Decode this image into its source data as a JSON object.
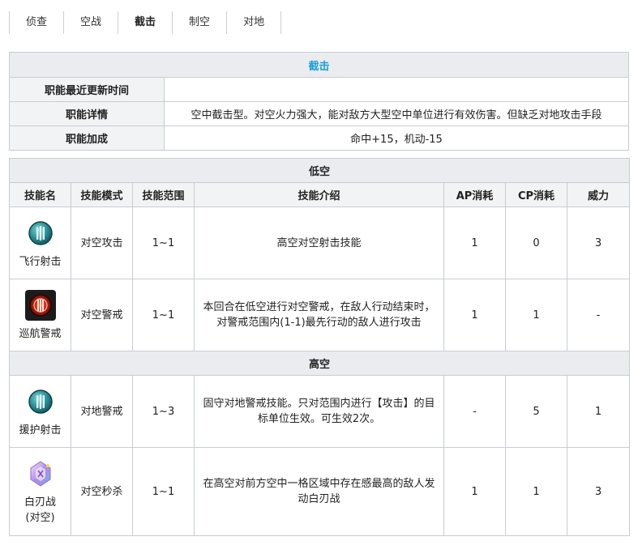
{
  "tabs": [
    "侦查",
    "空战",
    "截击",
    "制空",
    "对地"
  ],
  "active_tab": "截击",
  "info": {
    "title": "截击",
    "rows": [
      {
        "label": "职能最近更新时间",
        "value": ""
      },
      {
        "label": "职能详情",
        "value": "空中截击型。对空火力强大，能对敌方大型空中单位进行有效伤害。但缺乏对地攻击手段"
      },
      {
        "label": "职能加成",
        "value": "命中+15，机动-15"
      }
    ]
  },
  "skills": {
    "headers": [
      "技能名",
      "技能模式",
      "技能范围",
      "技能介绍",
      "AP消耗",
      "CP消耗",
      "威力"
    ],
    "sections": [
      {
        "title": "低空",
        "rows": [
          {
            "name": "飞行射击",
            "icon": "teal-badge-icon",
            "mode": "对空攻击",
            "range": "1~1",
            "desc": "高空对空射击技能",
            "ap": "1",
            "cp": "0",
            "power": "3"
          },
          {
            "name": "巡航警戒",
            "icon": "red-alert-icon",
            "mode": "对空警戒",
            "range": "1~1",
            "desc": "本回合在低空进行对空警戒，在敌人行动结束时，对警戒范围内(1-1)最先行动的敌人进行攻击",
            "ap": "1",
            "cp": "1",
            "power": "-"
          }
        ]
      },
      {
        "title": "高空",
        "rows": [
          {
            "name": "援护射击",
            "icon": "teal-badge-icon",
            "mode": "对地警戒",
            "range": "1~3",
            "desc": "固守对地警戒技能。只对范围内进行【攻击】的目标单位生效。可生效2次。",
            "ap": "-",
            "cp": "5",
            "power": "1"
          },
          {
            "name": "白刃战(对空)",
            "name_line1": "白刃战",
            "name_line2": "(对空)",
            "icon": "purple-crystal-icon",
            "mode": "对空秒杀",
            "range": "1~1",
            "desc": "在高空对前方空中一格区域中存在感最高的敌人发动白刃战",
            "ap": "1",
            "cp": "1",
            "power": "3"
          }
        ]
      }
    ]
  },
  "colors": {
    "title_blue": "#1a9fd8",
    "header_bg": "#eaecf0",
    "border": "#c8ccd1"
  }
}
